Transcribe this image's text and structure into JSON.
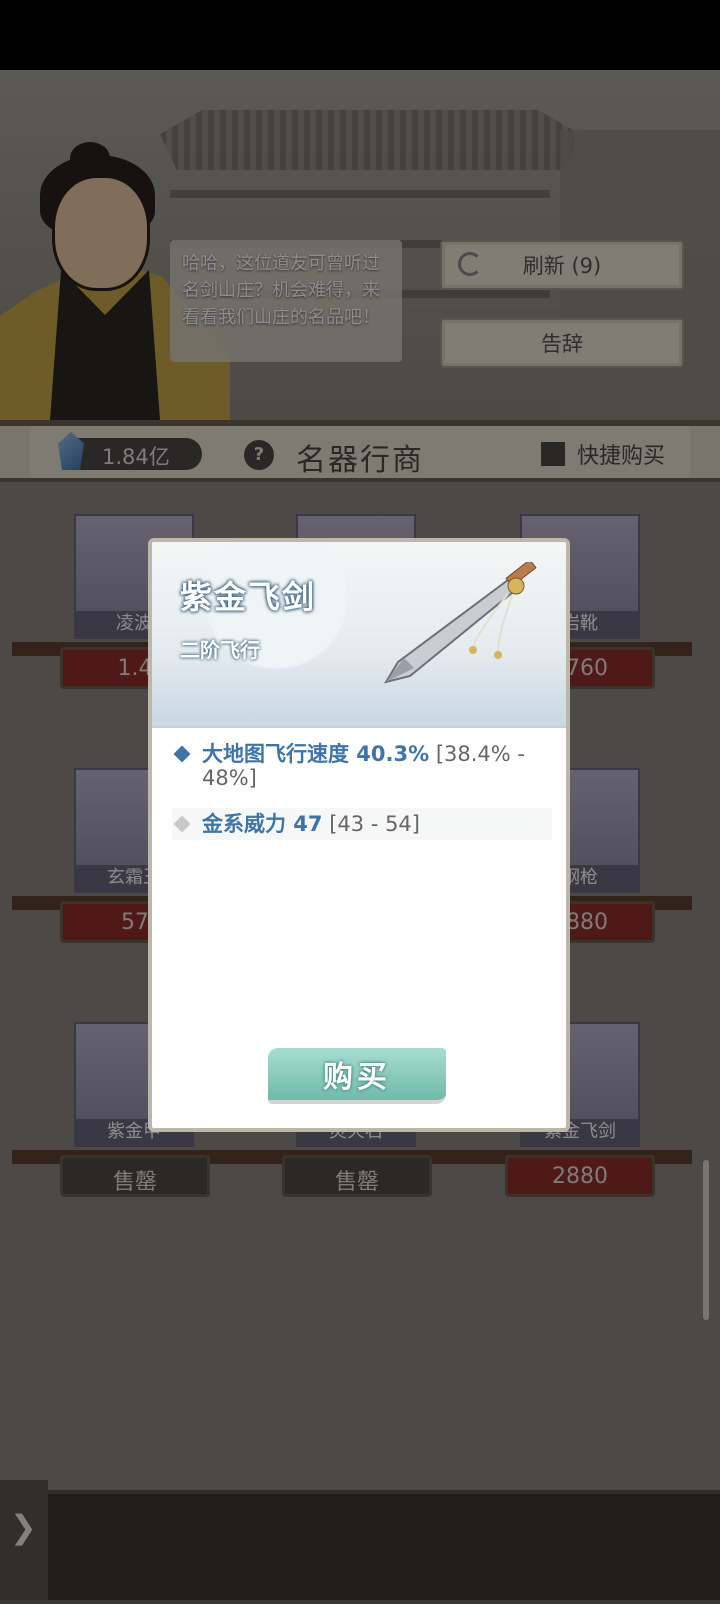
{
  "shopkeeper": {
    "speech": "哈哈，这位道友可曾听过名剑山庄？机会难得，来看看我们山庄的名品吧！"
  },
  "top_buttons": {
    "refresh_label": "刷新 (9)",
    "leave_label": "告辞"
  },
  "header": {
    "currency_amount": "1.84亿",
    "help_symbol": "?",
    "title": "名器行商",
    "quick_buy_label": "快捷购买"
  },
  "items": [
    {
      "name": "凌波",
      "price": "1.4"
    },
    {
      "name": "",
      "price": ""
    },
    {
      "name": "岩靴",
      "price": "5760"
    },
    {
      "name": "玄霜王",
      "price": "57"
    },
    {
      "name": "",
      "price": ""
    },
    {
      "name": "钢枪",
      "price": "2880"
    },
    {
      "name": "紫金甲",
      "price": "售罄"
    },
    {
      "name": "灵火石",
      "price": "售罄"
    },
    {
      "name": "紫金飞剑",
      "price": "2880"
    }
  ],
  "modal": {
    "title": "紫金飞剑",
    "subtitle": "二阶飞行",
    "stats": [
      {
        "name": "大地图飞行速度 40.3%",
        "range": " [38.4% - 48%]"
      },
      {
        "name": "金系威力 47",
        "range": " [43 - 54]"
      }
    ],
    "buy_label": "购买"
  },
  "side_arrow": "❯",
  "colors": {
    "stat_blue": "#3f74a8",
    "buy_green": "#6fbaa9",
    "price_red": "#8f2e2b"
  }
}
